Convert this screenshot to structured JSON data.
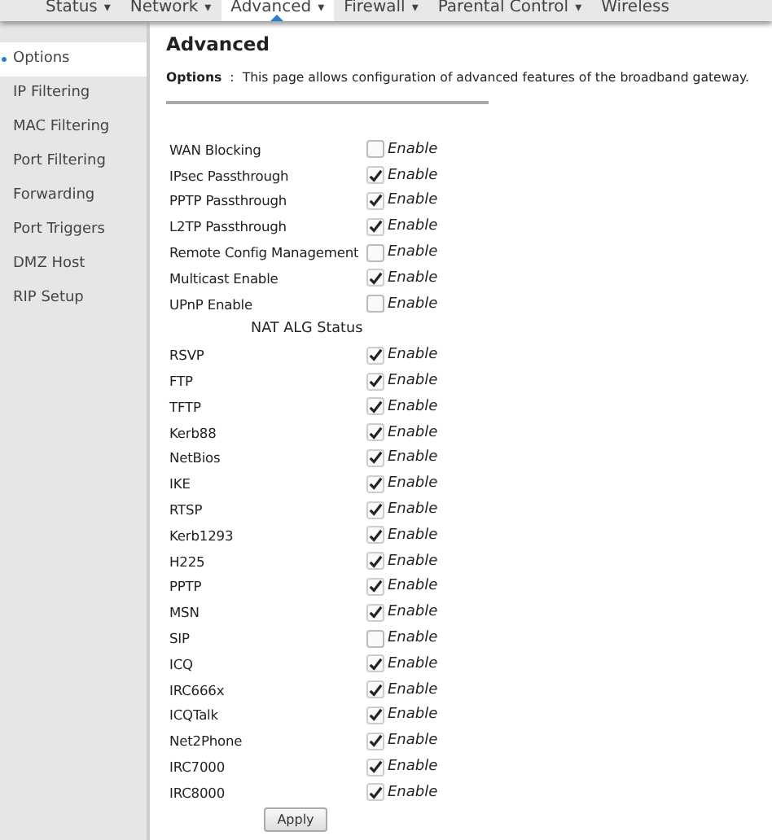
{
  "nav": [
    {
      "label": "Status",
      "selected": false,
      "caret": true
    },
    {
      "label": "Network",
      "selected": false,
      "caret": true
    },
    {
      "label": "Advanced",
      "selected": true,
      "caret": true
    },
    {
      "label": "Firewall",
      "selected": false,
      "caret": true
    },
    {
      "label": "Parental Control",
      "selected": false,
      "caret": true
    },
    {
      "label": "Wireless",
      "selected": false,
      "caret": false
    }
  ],
  "caret_glyph": "▾",
  "sidebar": {
    "items": [
      {
        "label": "Options",
        "selected": true
      },
      {
        "label": "IP Filtering",
        "selected": false
      },
      {
        "label": "MAC Filtering",
        "selected": false
      },
      {
        "label": "Port Filtering",
        "selected": false
      },
      {
        "label": "Forwarding",
        "selected": false
      },
      {
        "label": "Port Triggers",
        "selected": false
      },
      {
        "label": "DMZ Host",
        "selected": false
      },
      {
        "label": "RIP Setup",
        "selected": false
      }
    ]
  },
  "page_title": "Advanced",
  "description": {
    "label": "Options",
    "separator": ":",
    "text": "This page allows configuration of advanced features of the broadband gateway."
  },
  "settings": [
    {
      "label": "WAN Blocking",
      "checked": false,
      "option": "Enable"
    },
    {
      "label": "IPsec Passthrough",
      "checked": true,
      "option": "Enable"
    },
    {
      "label": "PPTP Passthrough",
      "checked": true,
      "option": "Enable"
    },
    {
      "label": "L2TP Passthrough",
      "checked": true,
      "option": "Enable"
    },
    {
      "label": "Remote Config Management",
      "checked": false,
      "option": "Enable"
    },
    {
      "label": "Multicast Enable",
      "checked": true,
      "option": "Enable"
    },
    {
      "label": "UPnP Enable",
      "checked": false,
      "option": "Enable"
    }
  ],
  "nat_alg": {
    "heading": "NAT ALG Status",
    "items": [
      {
        "label": "RSVP",
        "checked": true,
        "option": "Enable"
      },
      {
        "label": "FTP",
        "checked": true,
        "option": "Enable"
      },
      {
        "label": "TFTP",
        "checked": true,
        "option": "Enable"
      },
      {
        "label": "Kerb88",
        "checked": true,
        "option": "Enable"
      },
      {
        "label": "NetBios",
        "checked": true,
        "option": "Enable"
      },
      {
        "label": "IKE",
        "checked": true,
        "option": "Enable"
      },
      {
        "label": "RTSP",
        "checked": true,
        "option": "Enable"
      },
      {
        "label": "Kerb1293",
        "checked": true,
        "option": "Enable"
      },
      {
        "label": "H225",
        "checked": true,
        "option": "Enable"
      },
      {
        "label": "PPTP",
        "checked": true,
        "option": "Enable"
      },
      {
        "label": "MSN",
        "checked": true,
        "option": "Enable"
      },
      {
        "label": "SIP",
        "checked": false,
        "option": "Enable"
      },
      {
        "label": "ICQ",
        "checked": true,
        "option": "Enable"
      },
      {
        "label": "IRC666x",
        "checked": true,
        "option": "Enable"
      },
      {
        "label": "ICQTalk",
        "checked": true,
        "option": "Enable"
      },
      {
        "label": "Net2Phone",
        "checked": true,
        "option": "Enable"
      },
      {
        "label": "IRC7000",
        "checked": true,
        "option": "Enable"
      },
      {
        "label": "IRC8000",
        "checked": true,
        "option": "Enable"
      }
    ]
  },
  "apply_button": "Apply"
}
